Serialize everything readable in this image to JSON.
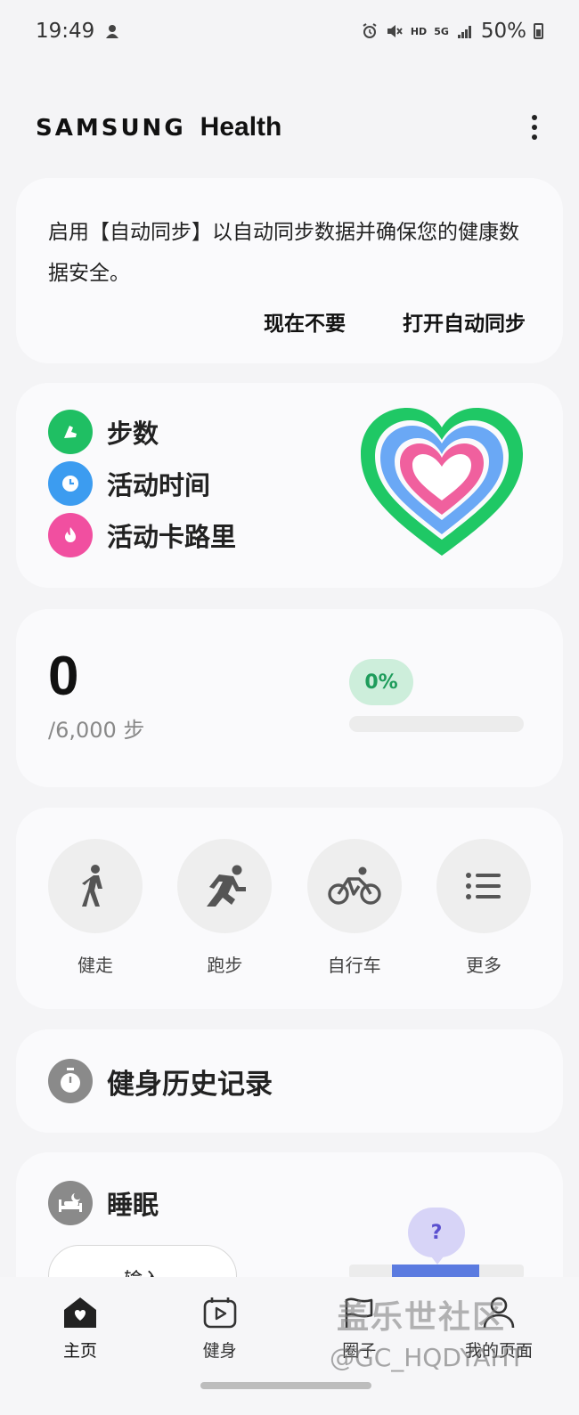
{
  "status_bar": {
    "time": "19:49",
    "network": "5G",
    "hd": "HD",
    "battery": "50%",
    "icons": [
      "notification-icon",
      "alarm-icon",
      "mute-icon",
      "signal-icon",
      "battery-icon"
    ]
  },
  "header": {
    "brand_samsung": "SAMSUNG",
    "brand_health": "Health"
  },
  "sync_card": {
    "message": "启用【自动同步】以自动同步数据并确保您的健康数据安全。",
    "not_now_label": "现在不要",
    "enable_label": "打开自动同步"
  },
  "together_card": {
    "items": [
      {
        "label": "步数",
        "icon": "shoe-icon",
        "color": "#1fbf63"
      },
      {
        "label": "活动时间",
        "icon": "clock-icon",
        "color": "#3c9cf0"
      },
      {
        "label": "活动卡路里",
        "icon": "flame-icon",
        "color": "#f14fa0"
      }
    ],
    "heart_colors": {
      "outer": "#1fc865",
      "middle": "#6aa8f5",
      "inner": "#f0609e"
    }
  },
  "steps_card": {
    "count": "0",
    "goal": "/6,000 步",
    "percent_label": "0%",
    "progress": 0
  },
  "workout_card": {
    "items": [
      {
        "label": "健走",
        "icon": "walk-icon"
      },
      {
        "label": "跑步",
        "icon": "run-icon"
      },
      {
        "label": "自行车",
        "icon": "bike-icon"
      },
      {
        "label": "更多",
        "icon": "list-icon"
      }
    ]
  },
  "history_card": {
    "title": "健身历史记录",
    "icon": "stopwatch-icon"
  },
  "sleep_card": {
    "title": "睡眠",
    "icon": "bed-icon",
    "input_label": "输入",
    "help_label": "?"
  },
  "bottom_nav": {
    "items": [
      {
        "label": "主页",
        "icon": "home-icon",
        "active": true
      },
      {
        "label": "健身",
        "icon": "fitness-icon",
        "active": false
      },
      {
        "label": "圈子",
        "icon": "flag-icon",
        "active": false
      },
      {
        "label": "我的页面",
        "icon": "person-icon",
        "active": false
      }
    ]
  },
  "watermark": {
    "line1": "盖乐世社区",
    "line2": "@GC_HQDYAHT"
  },
  "colors": {
    "background": "#f4f4f6",
    "card": "#fafafc",
    "accent_green": "#1e9c5b",
    "accent_blue": "#5b7be0"
  }
}
